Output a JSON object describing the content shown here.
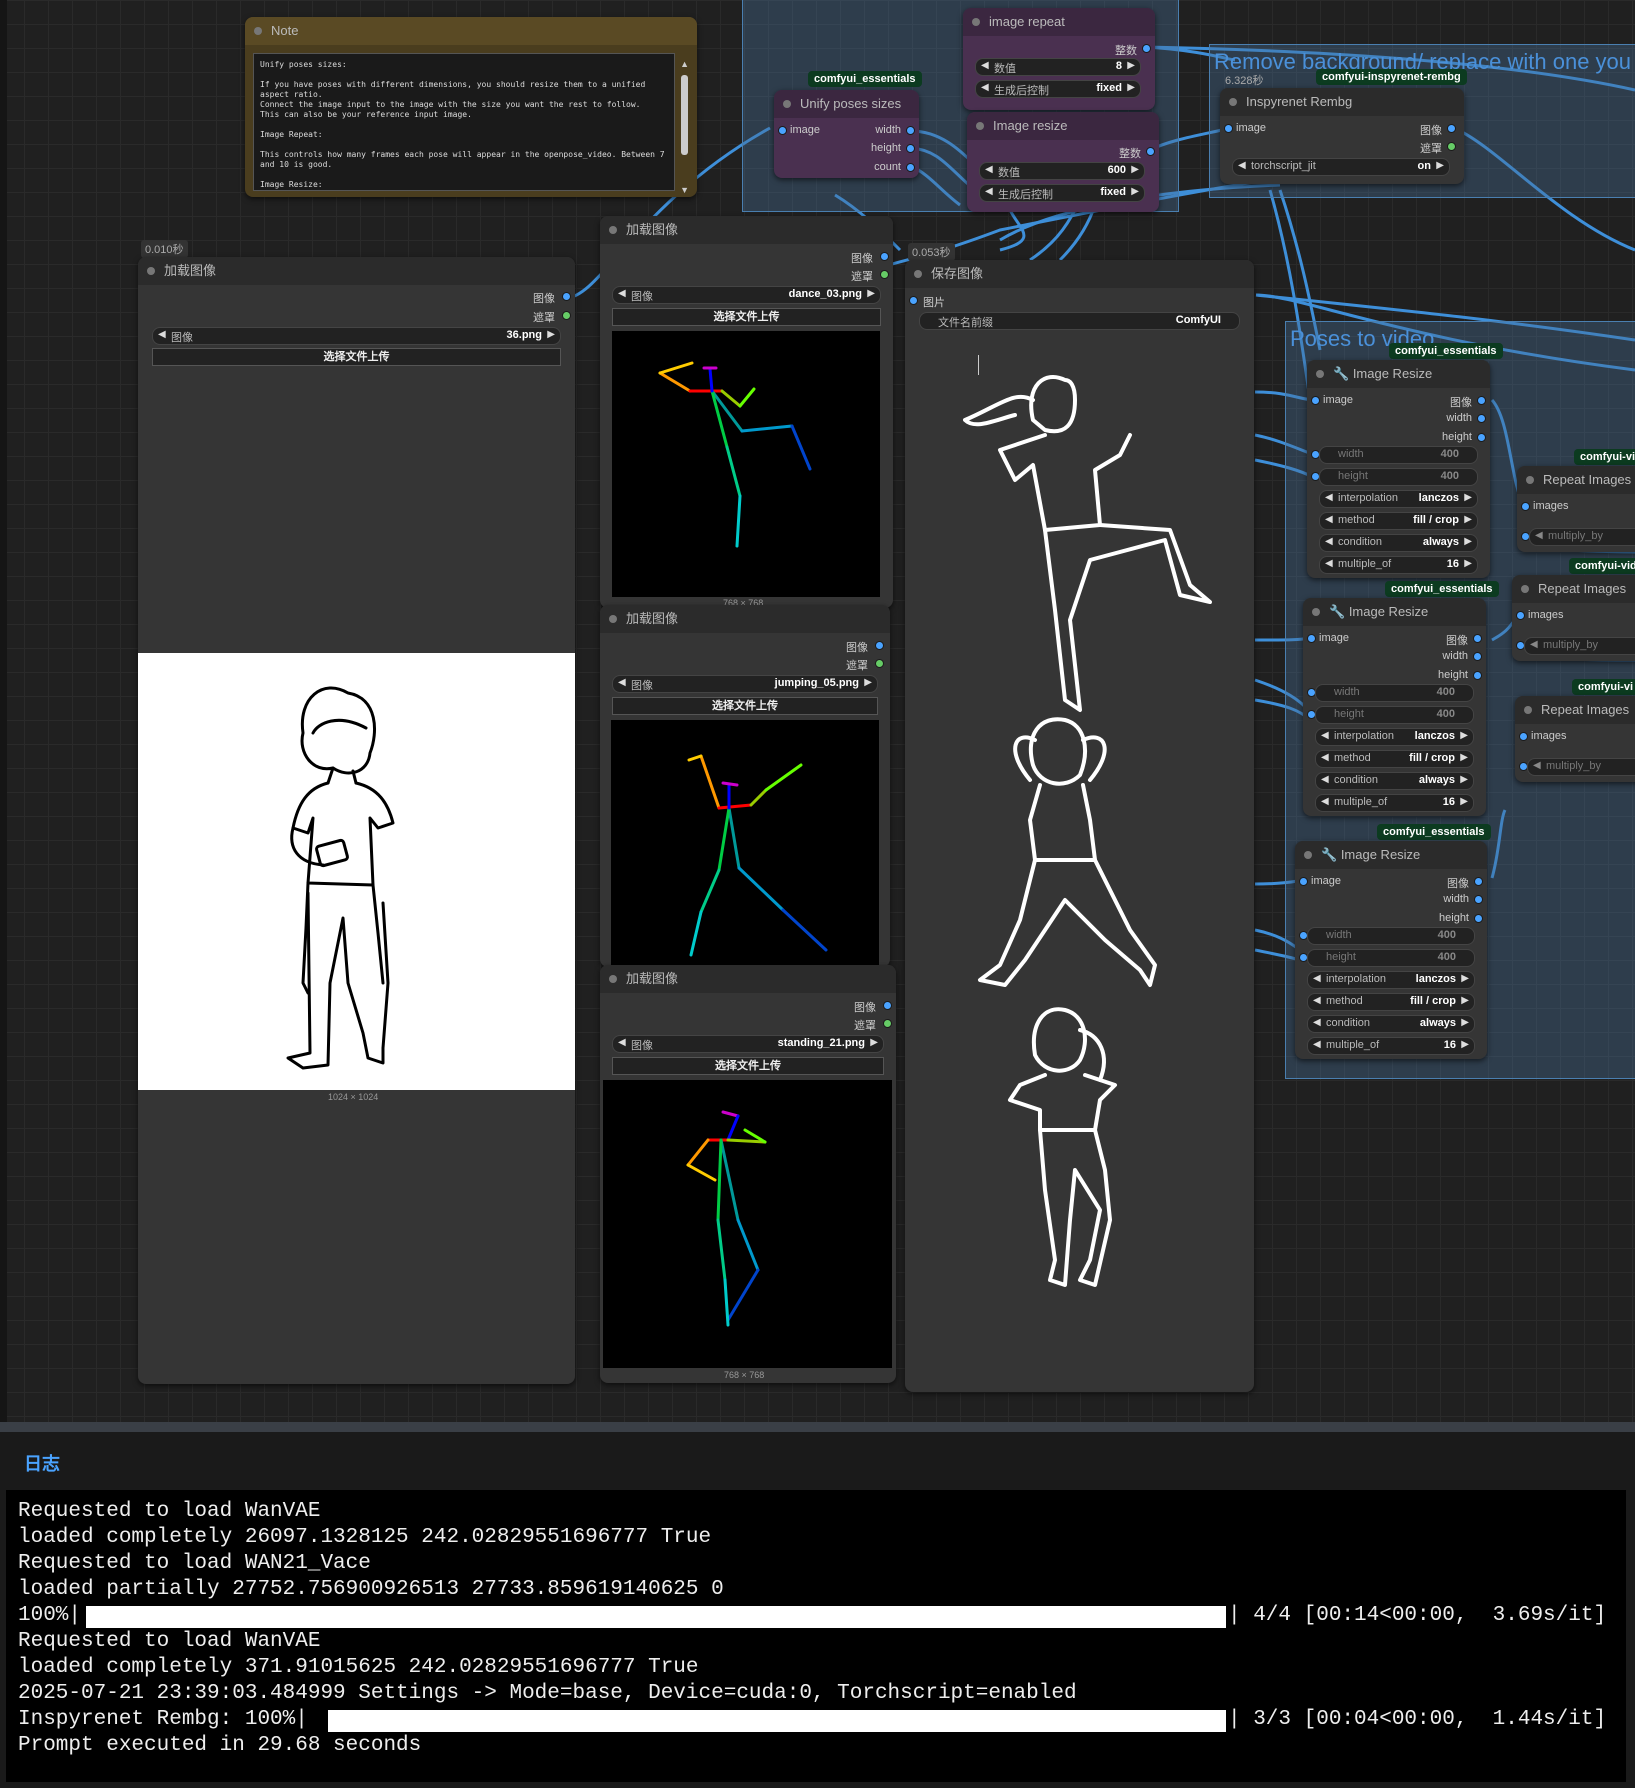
{
  "note": {
    "title": "Note",
    "text": "Unify poses sizes:\n\nIf you have poses with different dimensions, you should resize them to a unified aspect ratio.\nConnect the image input to the image with the size you want the rest to follow.\nThis can also be your reference input image.\n\nImage Repeat:\n\nThis controls how many frames each pose will appear in the openpose_video. Between 7 and 10 is good.\n\nImage Resize:"
  },
  "groups": {
    "remove_bg": "Remove background/ replace with one you",
    "poses_to_video": "Poses to video"
  },
  "unify_node": {
    "badge": "comfyui_essentials",
    "title": "Unify poses sizes",
    "in_image": "image",
    "out_width": "width",
    "out_height": "height",
    "out_count": "count"
  },
  "image_repeat_node": {
    "title": "image repeat",
    "out": "整数",
    "value_label": "数值",
    "value": "8",
    "ctrl_label": "生成后控制",
    "ctrl_value": "fixed"
  },
  "image_resize_small": {
    "title": "Image resize",
    "out": "整数",
    "value_label": "数值",
    "value": "600",
    "ctrl_label": "生成后控制",
    "ctrl_value": "fixed"
  },
  "rembg_node": {
    "time": "6.328秒",
    "badge": "comfyui-inspyrenet-rembg",
    "title": "Inspyrenet Rembg",
    "in_image": "image",
    "out_image": "图像",
    "out_mask": "遮罩",
    "widget_label": "torchscript_jit",
    "widget_value": "on"
  },
  "load_image_main": {
    "time": "0.010秒",
    "title": "加载图像",
    "out_image": "图像",
    "out_mask": "遮罩",
    "widget_label": "图像",
    "file": "36.png",
    "upload": "选择文件上传",
    "caption": "1024 × 1024"
  },
  "load_image_1": {
    "title": "加载图像",
    "out_image": "图像",
    "out_mask": "遮罩",
    "widget_label": "图像",
    "file": "dance_03.png",
    "upload": "选择文件上传",
    "caption": "768 × 768"
  },
  "load_image_2": {
    "title": "加载图像",
    "out_image": "图像",
    "out_mask": "遮罩",
    "widget_label": "图像",
    "file": "jumping_05.png",
    "upload": "选择文件上传"
  },
  "load_image_3": {
    "title": "加载图像",
    "out_image": "图像",
    "out_mask": "遮罩",
    "widget_label": "图像",
    "file": "standing_21.png",
    "upload": "选择文件上传",
    "caption": "768 × 768"
  },
  "save_image": {
    "time": "0.053秒",
    "title": "保存图像",
    "in_label": "图片",
    "prefix_label": "文件名前缀",
    "prefix_value": "ComfyUI"
  },
  "resize_nodes": [
    {
      "badge": "comfyui_essentials",
      "title": "Image Resize",
      "in_image": "image",
      "out_image": "图像",
      "out_width": "width",
      "out_height": "height",
      "width": "400",
      "height": "400",
      "interpolation": "lanczos",
      "method": "fill / crop",
      "condition": "always",
      "multiple_of": "16"
    },
    {
      "badge": "comfyui_essentials",
      "title": "Image Resize",
      "in_image": "image",
      "out_image": "图像",
      "out_width": "width",
      "out_height": "height",
      "width": "400",
      "height": "400",
      "interpolation": "lanczos",
      "method": "fill / crop",
      "condition": "always",
      "multiple_of": "16"
    },
    {
      "badge": "comfyui_essentials",
      "title": "Image Resize",
      "in_image": "image",
      "out_image": "图像",
      "out_width": "width",
      "out_height": "height",
      "width": "400",
      "height": "400",
      "interpolation": "lanczos",
      "method": "fill / crop",
      "condition": "always",
      "multiple_of": "16"
    }
  ],
  "widget_labels": {
    "width": "width",
    "height": "height",
    "interpolation": "interpolation",
    "method": "method",
    "condition": "condition",
    "multiple_of": "multiple_of"
  },
  "repeat_nodes": [
    {
      "badge": "comfyui-vi",
      "title": "Repeat Images",
      "in": "images",
      "widget": "multiply_by"
    },
    {
      "badge": "comfyui-vid",
      "title": "Repeat Images",
      "in": "images",
      "widget": "multiply_by"
    },
    {
      "badge": "comfyui-vi",
      "title": "Repeat Images",
      "in": "images",
      "widget": "multiply_by"
    }
  ],
  "log": {
    "title": "日志",
    "lines": [
      "Requested to load WanVAE",
      "loaded completely 26097.1328125 242.02829551696777 True",
      "Requested to load WAN21_Vace",
      "loaded partially 27752.756900926513 27733.859619140625 0",
      "100%|",
      "Requested to load WanVAE",
      "loaded completely 371.91015625 242.02829551696777 True",
      "2025-07-21 23:39:03.484999 Settings -> Mode=base, Device=cuda:0, Torchscript=enabled",
      "Inspyrenet Rembg: 100%|",
      "Prompt executed in 29.68 seconds"
    ],
    "progress1_tail": "| 4/4 [00:14<00:00,  3.69s/it]",
    "progress2_tail": "| 3/3 [00:04<00:00,  1.44s/it]",
    "progress1": 1.0,
    "progress2": 1.0
  }
}
